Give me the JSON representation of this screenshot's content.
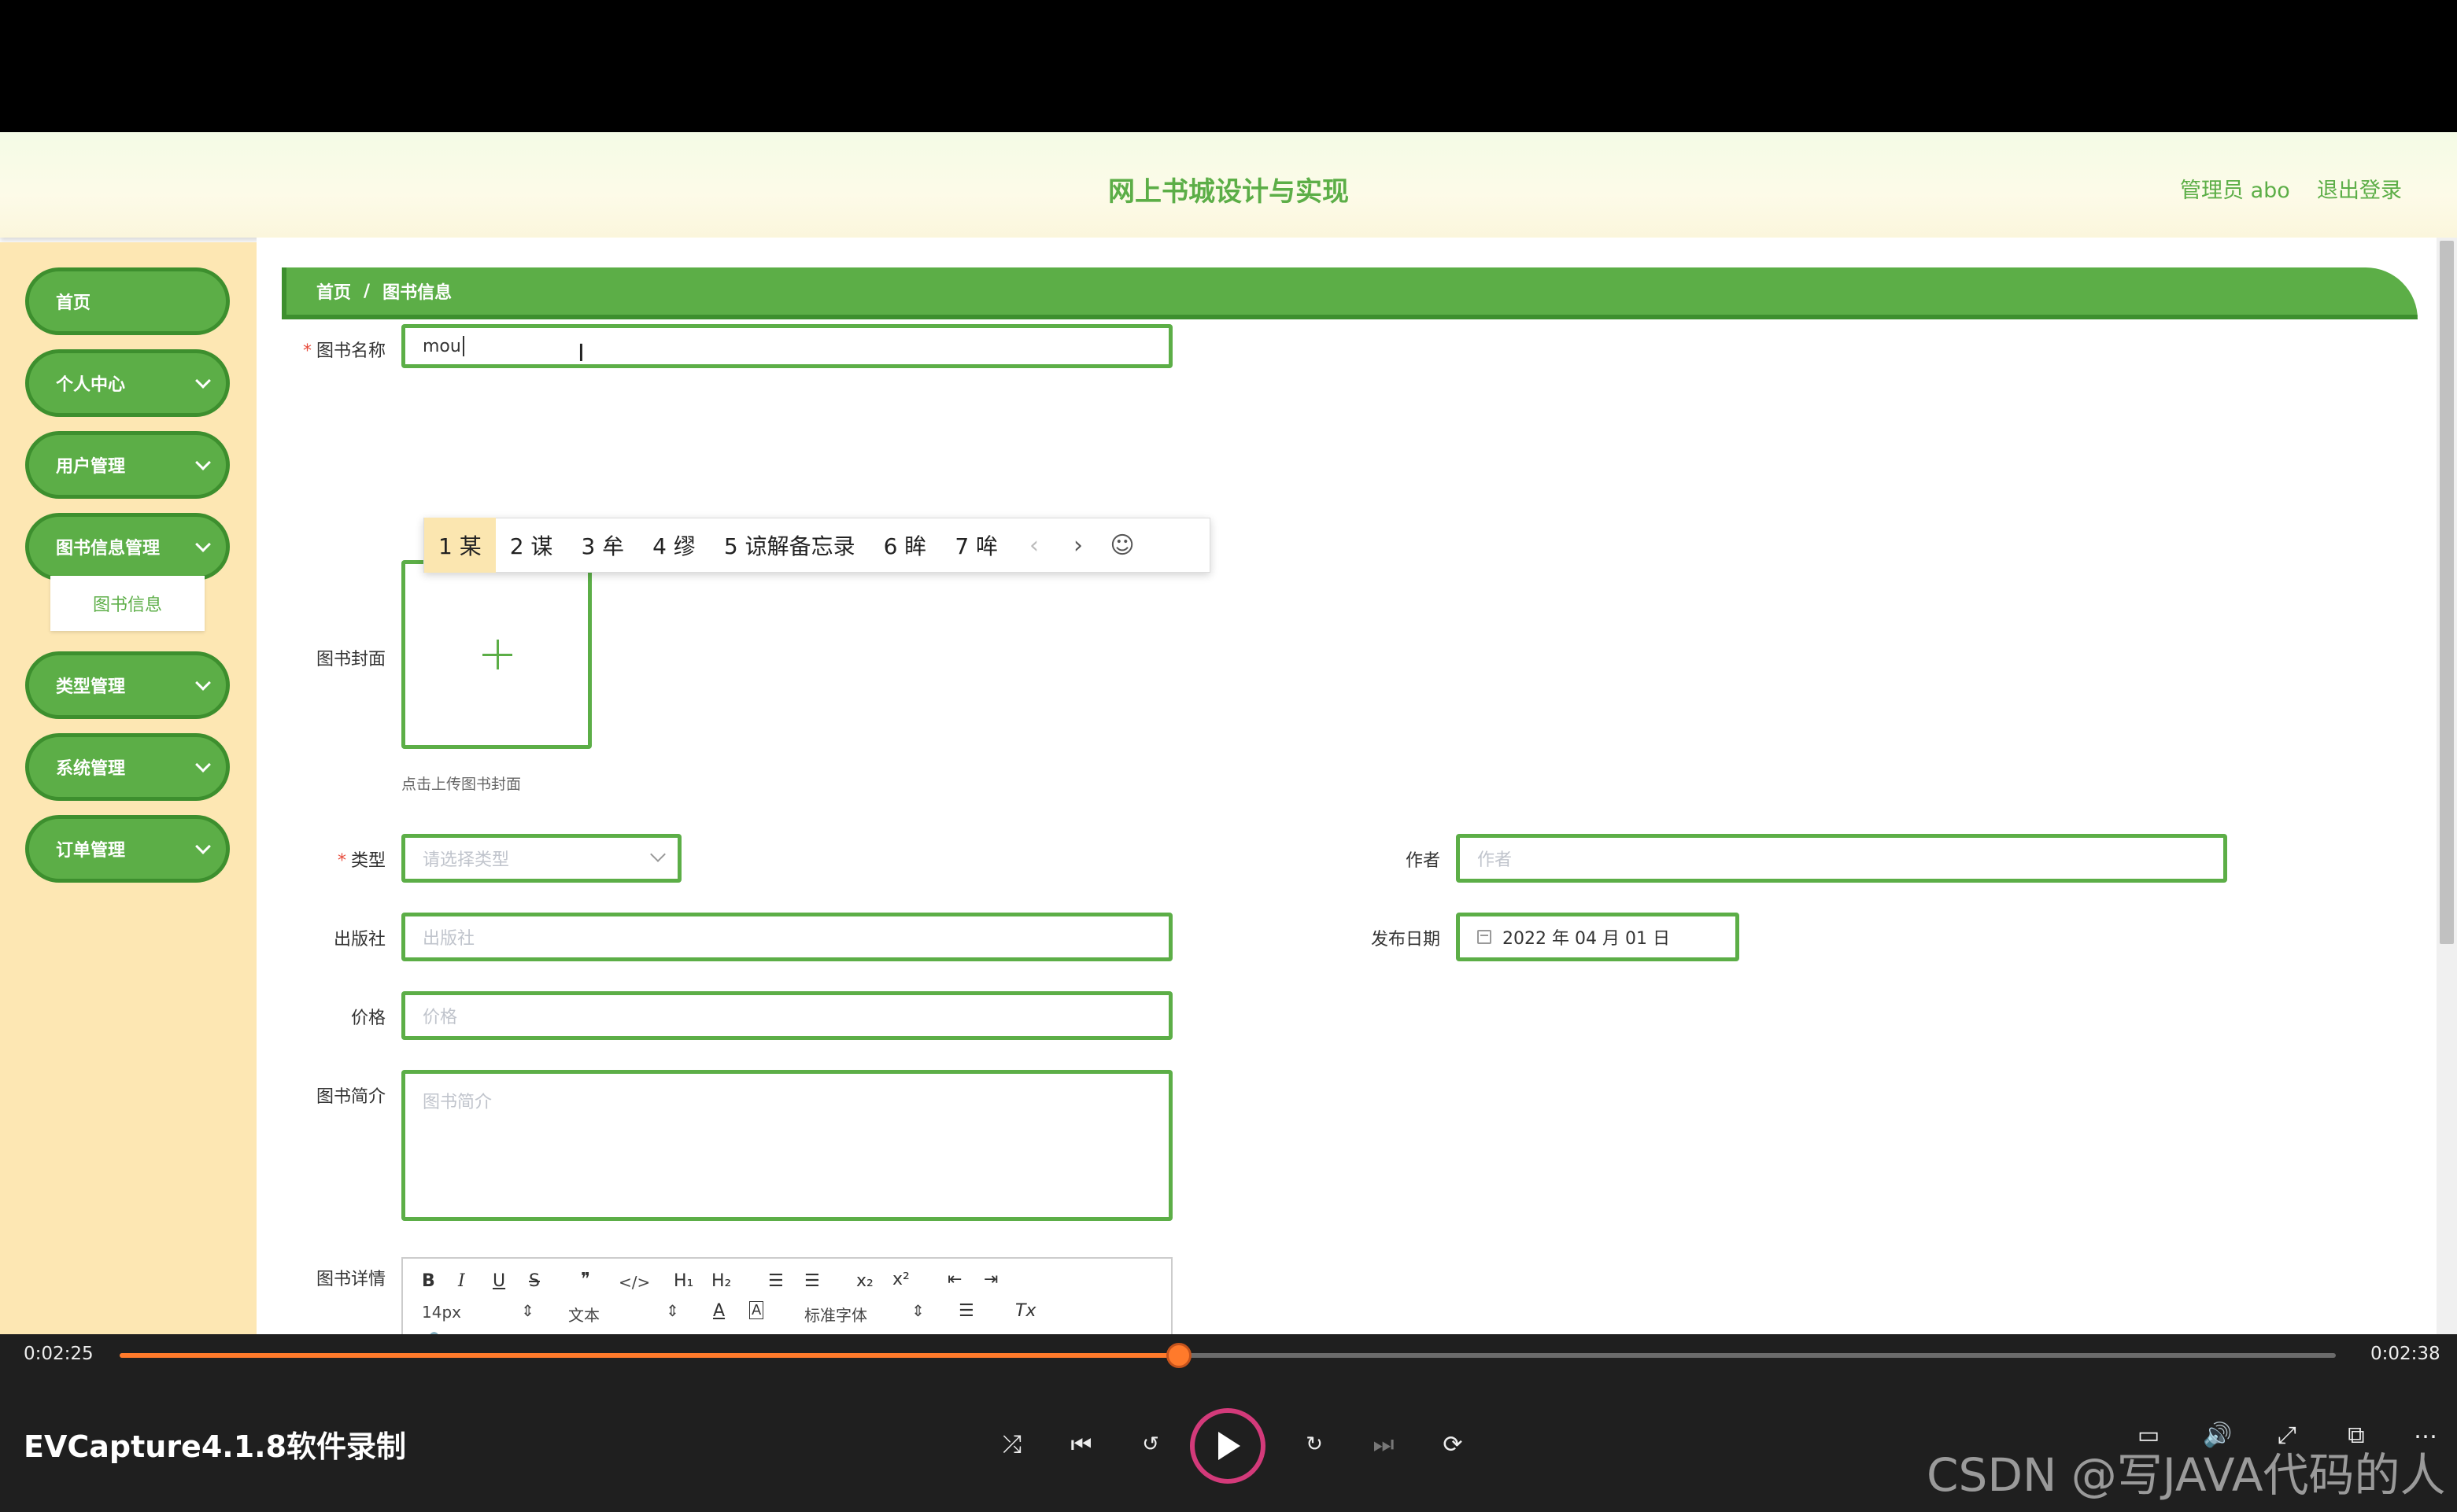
{
  "app": {
    "title": "网上书城设计与实现",
    "user_label": "管理员 abo",
    "logout_label": "退出登录"
  },
  "sidebar": {
    "items": [
      {
        "label": "首页",
        "has_children": false
      },
      {
        "label": "个人中心",
        "has_children": true
      },
      {
        "label": "用户管理",
        "has_children": true
      },
      {
        "label": "图书信息管理",
        "has_children": true
      },
      {
        "label": "类型管理",
        "has_children": true
      },
      {
        "label": "系统管理",
        "has_children": true
      },
      {
        "label": "订单管理",
        "has_children": true
      }
    ],
    "sub_item": "图书信息"
  },
  "breadcrumb": {
    "home": "首页",
    "separator": "/",
    "current": "图书信息"
  },
  "form": {
    "name_label": "图书名称",
    "name_value": "mou",
    "cover_label": "图书封面",
    "cover_hint": "点击上传图书封面",
    "type_label": "类型",
    "type_placeholder": "请选择类型",
    "author_label": "作者",
    "author_placeholder": "作者",
    "publisher_label": "出版社",
    "publisher_placeholder": "出版社",
    "date_label": "发布日期",
    "date_value": "2022 年 04 月 01 日",
    "price_label": "价格",
    "price_placeholder": "价格",
    "intro_label": "图书简介",
    "intro_placeholder": "图书简介",
    "detail_label": "图书详情"
  },
  "editor": {
    "bold": "B",
    "italic": "I",
    "underline": "U",
    "strike": "S",
    "quote": "❞",
    "code": "</>",
    "h1": "H₁",
    "h2": "H₂",
    "ordered": "☰",
    "bullet": "☰",
    "sub": "x₂",
    "sup": "x²",
    "outdent": "⇤",
    "indent": "⇥",
    "size": "14px",
    "format": "文本",
    "font": "标准字体",
    "color": "A",
    "bg": "A",
    "align": "☰",
    "clean": "Tx",
    "link": "🔗",
    "image": "▣",
    "video": "▦"
  },
  "ime": {
    "candidates": [
      "1 某",
      "2 谋",
      "3 牟",
      "4 缪",
      "5 谅解备忘录",
      "6 眸",
      "7 哞"
    ],
    "active_index": 0,
    "prev": "‹",
    "next": "›",
    "emoji": "☺"
  },
  "player": {
    "current_time": "0:02:25",
    "total_time": "0:02:38",
    "progress": 0.478,
    "title": "EVCapture4.1.8软件录制",
    "watermark": "CSDN @写JAVA代码的人",
    "accent": "#ff7a2b"
  }
}
